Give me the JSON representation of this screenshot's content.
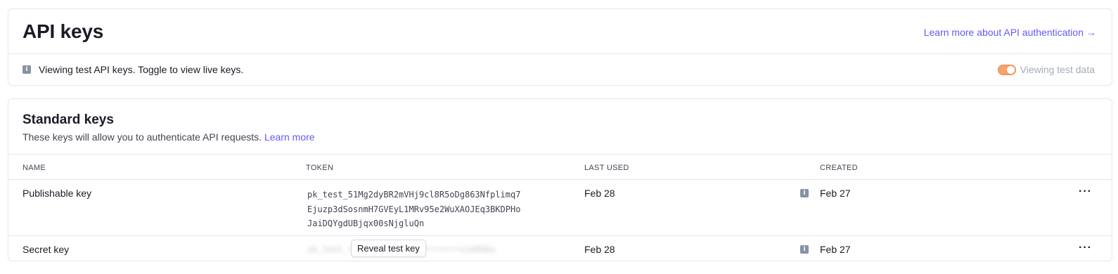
{
  "header": {
    "title": "API keys",
    "learn_more": "Learn more about API authentication",
    "learn_more_arrow": "→"
  },
  "notice": {
    "icon": "info-icon",
    "text": "Viewing test API keys. Toggle to view live keys.",
    "toggle_label": "Viewing test data",
    "toggle_on": true,
    "toggle_color": "#f5a36b"
  },
  "standard_keys": {
    "title": "Standard keys",
    "description": "These keys will allow you to authenticate API requests.",
    "learn_more": "Learn more",
    "columns": [
      "NAME",
      "TOKEN",
      "LAST USED",
      "CREATED"
    ],
    "rows": [
      {
        "name": "Publishable key",
        "token_lines": [
          "pk_test_51Mg2dyBR2mVHj9cl8R5oDg863Nfplimq7",
          "Ejuzp3dSosnmH7GVEyL1MRv95e2WuXAOJEq3BKDPHo",
          "JaiDQYgdUBjqx00sNjgluQn"
        ],
        "last_used": "Feb 28",
        "created": "Feb 27",
        "more": "···"
      },
      {
        "name": "Secret key",
        "reveal_label": "Reveal test key",
        "last_used": "Feb 28",
        "created": "Feb 27",
        "more": "···"
      }
    ]
  },
  "colors": {
    "link": "#625afa",
    "border": "#e3e8ee",
    "text": "#1a1b25",
    "muted": "#a3acb9"
  }
}
